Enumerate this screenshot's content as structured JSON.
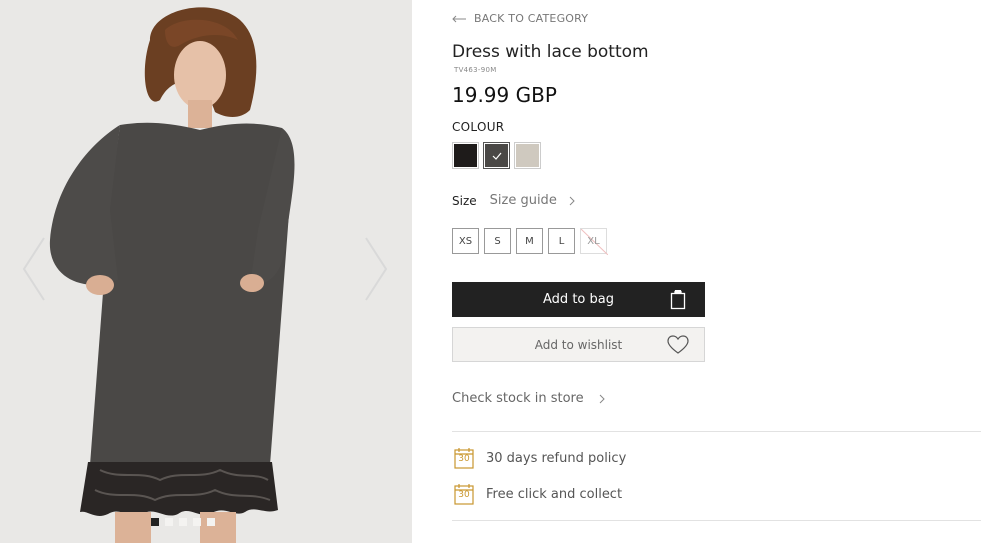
{
  "navigation": {
    "back_label": "BACK TO CATEGORY"
  },
  "product": {
    "title": "Dress with lace bottom",
    "sku": "TV463-90M",
    "price": "19.99 GBP"
  },
  "colour": {
    "label": "COLOUR",
    "swatches": [
      {
        "name": "black",
        "color": "#1e1b1a",
        "selected": false
      },
      {
        "name": "dark-grey",
        "color": "#4a4846",
        "selected": true
      },
      {
        "name": "light-beige",
        "color": "#cfc9bf",
        "selected": false
      }
    ]
  },
  "size": {
    "label": "Size",
    "guide_label": "Size guide",
    "options": [
      {
        "label": "XS",
        "available": true
      },
      {
        "label": "S",
        "available": true
      },
      {
        "label": "M",
        "available": true
      },
      {
        "label": "L",
        "available": true
      },
      {
        "label": "XL",
        "available": false
      }
    ]
  },
  "actions": {
    "add_to_bag": "Add to bag",
    "add_to_wishlist": "Add to wishlist",
    "check_stock": "Check stock in store"
  },
  "perks": {
    "calendar_number": "30",
    "refund": "30 days refund policy",
    "collect": "Free click and collect"
  },
  "gallery": {
    "image_count": 5,
    "active_index": 0
  },
  "colors": {
    "button_dark": "#222222",
    "accent_gold": "#c9962e"
  }
}
